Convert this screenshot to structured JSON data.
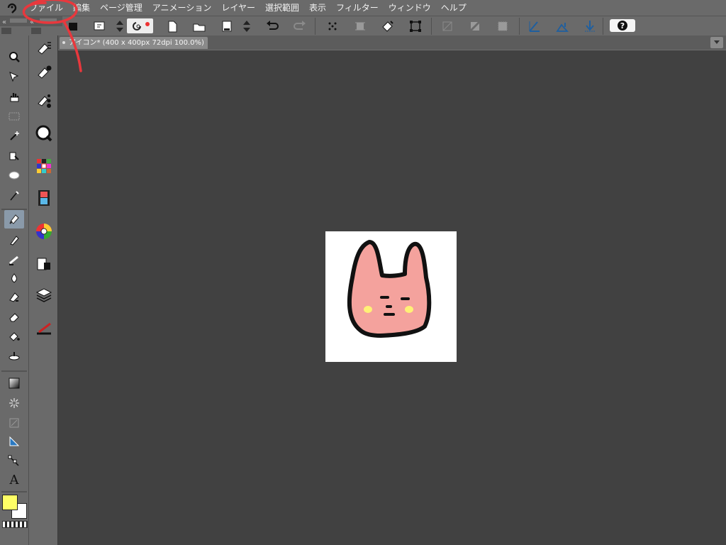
{
  "menubar": {
    "items": [
      "ファイル",
      "編集",
      "ページ管理",
      "アニメーション",
      "レイヤー",
      "選択範囲",
      "表示",
      "フィルター",
      "ウィンドウ",
      "ヘルプ"
    ]
  },
  "document_tab": {
    "title": "アイコン* (400 x 400px 72dpi 100.0%)"
  },
  "toolbar": {
    "help_label": "?"
  },
  "tools": {
    "text_tool_label": "A"
  },
  "colors": {
    "main_color": "#ffff66",
    "sub_color": "#ffffff",
    "annotation": "#e8383d",
    "character_fill": "#f4a29d",
    "cheek": "#fff176"
  }
}
